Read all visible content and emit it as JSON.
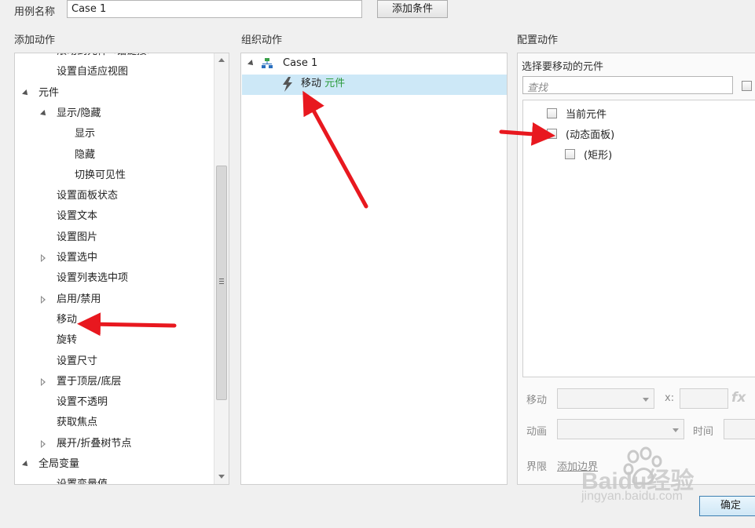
{
  "header": {
    "case_name_label": "用例名称",
    "case_name_value": "Case 1",
    "add_condition_button": "添加条件"
  },
  "add_action": {
    "title": "添加动作",
    "items": [
      {
        "label": "滚动到元件<锚链接>",
        "level": 2,
        "expander": "none"
      },
      {
        "label": "设置自适应视图",
        "level": 2,
        "expander": "none"
      },
      {
        "label": "元件",
        "level": 1,
        "expander": "expanded"
      },
      {
        "label": "显示/隐藏",
        "level": 2,
        "expander": "expanded"
      },
      {
        "label": "显示",
        "level": 3,
        "expander": "none"
      },
      {
        "label": "隐藏",
        "level": 3,
        "expander": "none"
      },
      {
        "label": "切换可见性",
        "level": 3,
        "expander": "none"
      },
      {
        "label": "设置面板状态",
        "level": 2,
        "expander": "none"
      },
      {
        "label": "设置文本",
        "level": 2,
        "expander": "none"
      },
      {
        "label": "设置图片",
        "level": 2,
        "expander": "none"
      },
      {
        "label": "设置选中",
        "level": 2,
        "expander": "collapsed"
      },
      {
        "label": "设置列表选中项",
        "level": 2,
        "expander": "none"
      },
      {
        "label": "启用/禁用",
        "level": 2,
        "expander": "collapsed"
      },
      {
        "label": "移动",
        "level": 2,
        "expander": "none"
      },
      {
        "label": "旋转",
        "level": 2,
        "expander": "none"
      },
      {
        "label": "设置尺寸",
        "level": 2,
        "expander": "none"
      },
      {
        "label": "置于顶层/底层",
        "level": 2,
        "expander": "collapsed"
      },
      {
        "label": "设置不透明",
        "level": 2,
        "expander": "none"
      },
      {
        "label": "获取焦点",
        "level": 2,
        "expander": "none"
      },
      {
        "label": "展开/折叠树节点",
        "level": 2,
        "expander": "collapsed"
      },
      {
        "label": "全局变量",
        "level": 1,
        "expander": "expanded"
      },
      {
        "label": "设置变量值",
        "level": 2,
        "expander": "none"
      }
    ]
  },
  "organize_action": {
    "title": "组织动作",
    "case_label": "Case 1",
    "action_verb": "移动",
    "action_target": "元件"
  },
  "config_action": {
    "title": "配置动作",
    "select_label": "选择要移动的元件",
    "search_placeholder": "查找",
    "widgets": [
      {
        "label": "当前元件",
        "indent": 0
      },
      {
        "label": "(动态面板)",
        "indent": 0
      },
      {
        "label": "(矩形)",
        "indent": 1
      }
    ],
    "move_label": "移动",
    "x_label": "x:",
    "fx_label": "fx",
    "animation_label": "动画",
    "time_label": "时间",
    "boundary_label": "界限",
    "add_boundary_link": "添加边界",
    "ok_button": "确定"
  },
  "watermark": {
    "text": "Baidu经验",
    "url_text": "jingyan.baidu.com"
  },
  "colors": {
    "arrow": "#e8181f",
    "selection": "#cde8f7",
    "accent_green": "#2a9a3a"
  }
}
